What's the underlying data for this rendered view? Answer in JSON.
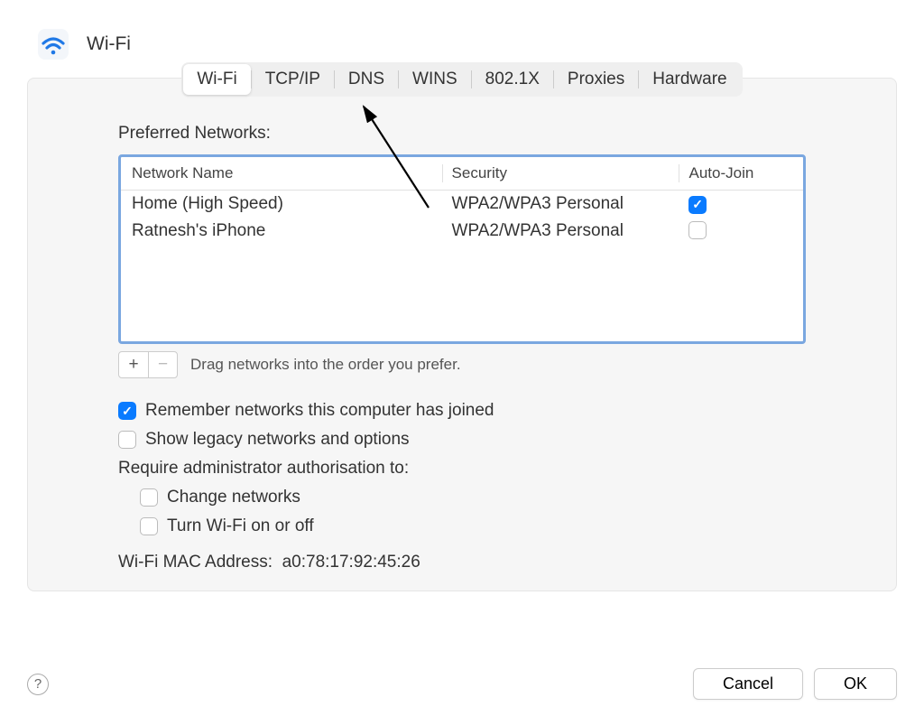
{
  "header": {
    "title": "Wi-Fi"
  },
  "tabs": [
    "Wi-Fi",
    "TCP/IP",
    "DNS",
    "WINS",
    "802.1X",
    "Proxies",
    "Hardware"
  ],
  "active_tab": 0,
  "preferred_networks_label": "Preferred Networks:",
  "table": {
    "columns": {
      "name": "Network Name",
      "security": "Security",
      "auto": "Auto-Join"
    },
    "rows": [
      {
        "name": "Home (High Speed)",
        "security": "WPA2/WPA3 Personal",
        "auto_join": true
      },
      {
        "name": "Ratnesh's iPhone",
        "security": "WPA2/WPA3 Personal",
        "auto_join": false
      }
    ]
  },
  "add_label": "+",
  "remove_label": "−",
  "drag_hint": "Drag networks into the order you prefer.",
  "remember_label": "Remember networks this computer has joined",
  "remember_checked": true,
  "show_legacy_label": "Show legacy networks and options",
  "show_legacy_checked": false,
  "require_label": "Require administrator authorisation to:",
  "change_networks_label": "Change networks",
  "change_networks_checked": false,
  "turn_wifi_label": "Turn Wi-Fi on or off",
  "turn_wifi_checked": false,
  "mac_label": "Wi-Fi MAC Address:",
  "mac_value": "a0:78:17:92:45:26",
  "help_label": "?",
  "cancel_label": "Cancel",
  "ok_label": "OK"
}
